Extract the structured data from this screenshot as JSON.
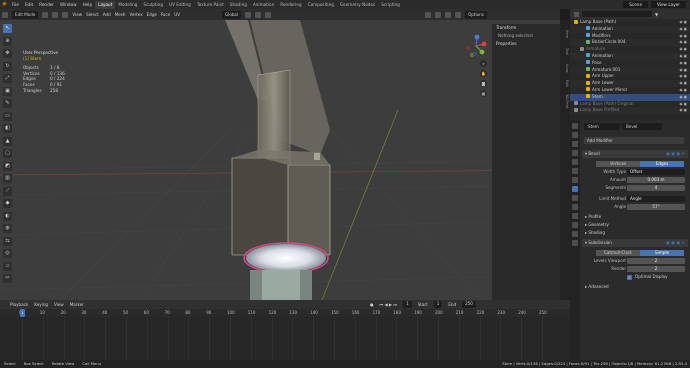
{
  "topbar": {
    "menus": [
      "File",
      "Edit",
      "Render",
      "Window",
      "Help"
    ],
    "workspaces": [
      "Layout",
      "Modeling",
      "Sculpting",
      "UV Editing",
      "Texture Paint",
      "Shading",
      "Animation",
      "Rendering",
      "Compositing",
      "Geometry Nodes",
      "Scripting"
    ],
    "scene": "Scene",
    "view_layer": "View Layer"
  },
  "viewport_header": {
    "mode": "Edit Mode",
    "menus": [
      "View",
      "Select",
      "Add",
      "Mesh",
      "Vertex",
      "Edge",
      "Face",
      "UV"
    ],
    "orientation": "Global",
    "options": "Options"
  },
  "overlay": {
    "view": "User Perspective",
    "object": "(1) Stem",
    "stats": [
      {
        "label": "Objects",
        "value": "1 / 8"
      },
      {
        "label": "Vertices",
        "value": "0 / 136"
      },
      {
        "label": "Edges",
        "value": "0 / 224"
      },
      {
        "label": "Faces",
        "value": "0 / 91"
      },
      {
        "label": "Triangles",
        "value": "258"
      }
    ]
  },
  "npanel": {
    "transform": "Transform",
    "nothing": "Nothing selected",
    "properties": "Properties",
    "tabs": [
      "Item",
      "Tool",
      "View",
      "Edit",
      "3D-Print"
    ]
  },
  "outliner": {
    "rows": [
      {
        "name": "Lamp Base (Path)",
        "indent": 0,
        "color": "#e0b500",
        "dim": false,
        "sel": false
      },
      {
        "name": "Animation",
        "indent": 2,
        "color": "#4fa3c7",
        "dim": false,
        "sel": false
      },
      {
        "name": "Modifiers",
        "indent": 2,
        "color": "#5fa0d8",
        "dim": false,
        "sel": false
      },
      {
        "name": "BezierCircle.004",
        "indent": 2,
        "color": "#6bb36b",
        "dim": false,
        "sel": false
      },
      {
        "name": "Armature",
        "indent": 1,
        "color": "#8c8c8c",
        "dim": true,
        "sel": false
      },
      {
        "name": "Animation",
        "indent": 2,
        "color": "#4fa3c7",
        "dim": false,
        "sel": false
      },
      {
        "name": "Pose",
        "indent": 2,
        "color": "#5fa0d8",
        "dim": false,
        "sel": false
      },
      {
        "name": "Armature.001",
        "indent": 2,
        "color": "#6bb36b",
        "dim": false,
        "sel": false
      },
      {
        "name": "Arm Upper",
        "indent": 2,
        "color": "#e0b500",
        "dim": false,
        "sel": false
      },
      {
        "name": "Arm Lower",
        "indent": 2,
        "color": "#e0b500",
        "dim": false,
        "sel": false
      },
      {
        "name": "Arm Lower Mirror",
        "indent": 2,
        "color": "#e0b500",
        "dim": false,
        "sel": false
      },
      {
        "name": "Stem",
        "indent": 2,
        "color": "#e0b500",
        "dim": false,
        "sel": true
      },
      {
        "name": "Lamp Base (Path) Original",
        "indent": 0,
        "color": "#8c8c8c",
        "dim": true,
        "sel": false
      },
      {
        "name": "Lamp Base Profiled",
        "indent": 0,
        "color": "#8c8c8c",
        "dim": true,
        "sel": false
      }
    ]
  },
  "properties": {
    "object_name": "Stem",
    "modifier_name": "Bevel",
    "add_modifier": "Add Modifier",
    "bevel": {
      "name": "Bevel",
      "tabs": [
        "Vertices",
        "Edges"
      ],
      "active_tab": "Edges",
      "width_type": {
        "label": "Width Type",
        "value": "Offset"
      },
      "amount": {
        "label": "Amount",
        "value": "0.003 m"
      },
      "segments": {
        "label": "Segments",
        "value": "4"
      },
      "limit_method": {
        "label": "Limit Method",
        "value": "Angle"
      },
      "angle": {
        "label": "Angle",
        "value": "57°"
      },
      "profile": "Profile",
      "geometry": "Geometry",
      "shading": "Shading"
    },
    "subdivision": {
      "name": "Subdivision",
      "tabs": [
        "Catmull-Clark",
        "Simple"
      ],
      "active_tab": "Simple",
      "levels_viewport": {
        "label": "Levels Viewport",
        "value": "2"
      },
      "render": {
        "label": "Render",
        "value": "2"
      },
      "optimal_display": "Optimal Display",
      "advanced": "Advanced"
    }
  },
  "timeline": {
    "menus": [
      "Playback",
      "Keying",
      "View",
      "Marker"
    ],
    "current_frame": "1",
    "start_label": "Start",
    "start": "1",
    "end_label": "End",
    "end": "250",
    "ticks": [
      "0",
      "10",
      "20",
      "30",
      "40",
      "50",
      "60",
      "70",
      "80",
      "90",
      "100",
      "110",
      "120",
      "130",
      "140",
      "150",
      "160",
      "170",
      "180",
      "190",
      "200",
      "210",
      "220",
      "230",
      "240",
      "250"
    ],
    "playhead_label": "1"
  },
  "status": {
    "left": [
      "Select",
      "Box Select",
      "Rotate View",
      "Call Menu"
    ],
    "right": "Stem | Verts:0/136 | Edges:0/224 | Faces:0/91 | Tris:258 | Objects:1/8 | Memory: 61.2 MiB | 2.93.4"
  },
  "colors": {
    "accent": "#4772b3",
    "selected_object": "#e0b500",
    "highlight_ellipse": "#d04a8a"
  }
}
